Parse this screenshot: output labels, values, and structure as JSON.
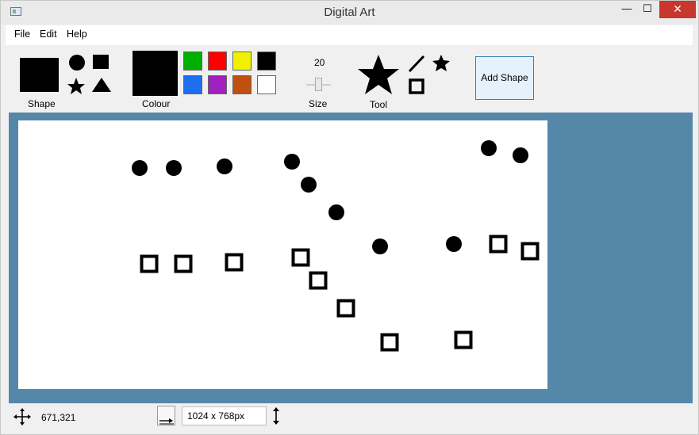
{
  "window": {
    "title": "Digital Art"
  },
  "titlebar": {
    "minimize": "—",
    "maximize": "☐",
    "close": "✕"
  },
  "menu": [
    {
      "label": "File"
    },
    {
      "label": "Edit"
    },
    {
      "label": "Help"
    }
  ],
  "toolbar": {
    "shape_label": "Shape",
    "colour_label": "Colour",
    "size_label": "Size",
    "size_value": "20",
    "tool_label": "Tool",
    "add_shape": "Add Shape",
    "selected_shape": "square",
    "selected_colour": "#000000",
    "selected_tool": "star",
    "colours": [
      "#00b000",
      "#ff0000",
      "#f0f000",
      "#000000",
      "#1e6ef0",
      "#a020c0",
      "#c05010",
      "#ffffff"
    ]
  },
  "status": {
    "cursor_position": "671,321",
    "canvas_size": "1024 x 768px"
  },
  "canvas": {
    "shapes": [
      {
        "type": "circle",
        "color": "#000000"
      },
      {
        "type": "circle",
        "color": "#000000"
      },
      {
        "type": "circle",
        "color": "#000000"
      },
      {
        "type": "circle",
        "color": "#000000"
      },
      {
        "type": "circle",
        "color": "#000000"
      },
      {
        "type": "circle",
        "color": "#000000"
      },
      {
        "type": "circle",
        "color": "#000000"
      },
      {
        "type": "circle",
        "color": "#000000"
      },
      {
        "type": "circle",
        "color": "#000000"
      },
      {
        "type": "circle",
        "color": "#000000"
      },
      {
        "type": "square",
        "color": "#000000"
      },
      {
        "type": "square",
        "color": "#000000"
      },
      {
        "type": "square",
        "color": "#000000"
      },
      {
        "type": "square",
        "color": "#000000"
      },
      {
        "type": "square",
        "color": "#000000"
      },
      {
        "type": "square",
        "color": "#000000"
      },
      {
        "type": "square",
        "color": "#000000"
      },
      {
        "type": "square",
        "color": "#000000"
      },
      {
        "type": "square",
        "color": "#000000"
      },
      {
        "type": "square",
        "color": "#000000"
      }
    ]
  }
}
